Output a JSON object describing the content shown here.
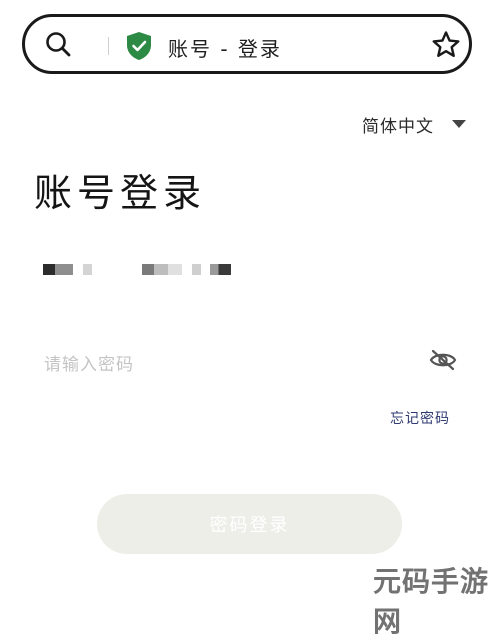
{
  "address_bar": {
    "title": "账号 - 登录",
    "secure_icon": "shield-check-icon"
  },
  "language": {
    "label": "简体中文"
  },
  "page": {
    "heading": "账号登录"
  },
  "account": {
    "value": ""
  },
  "password": {
    "placeholder": "请输入密码"
  },
  "links": {
    "forgot": "忘记密码"
  },
  "buttons": {
    "login": "密码登录"
  },
  "watermark": {
    "text": "元码手游网"
  },
  "colors": {
    "shield": "#2d8a45",
    "link": "#2f3a70",
    "button_bg": "#eeeee8",
    "placeholder": "#c4c4c4"
  }
}
